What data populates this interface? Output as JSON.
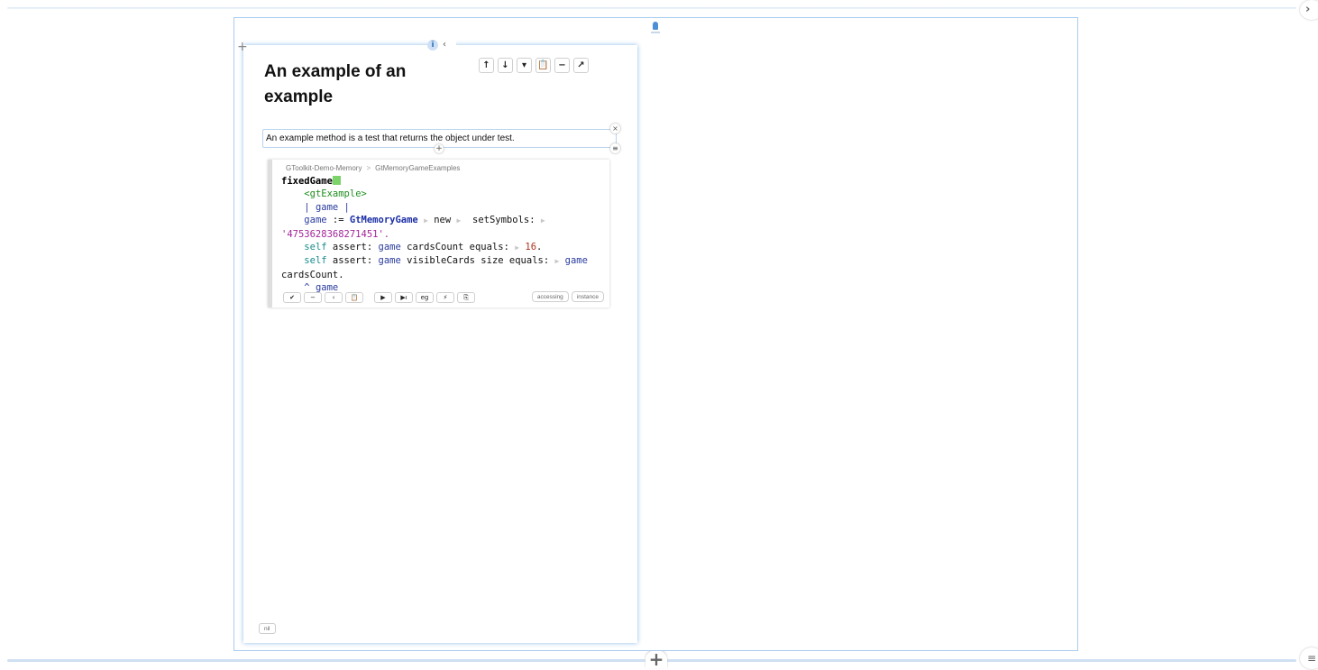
{
  "world": {
    "close_icon": "close-icon",
    "menu_icon": "menu-icon",
    "add_label": "+"
  },
  "page": {
    "title": "An example of an example",
    "add_label": "+",
    "tab_icon": "pin-icon",
    "tab_label": "ĭ",
    "tab_chevron": "‹",
    "toolbar": [
      {
        "name": "move-up-button",
        "glyph": "↑"
      },
      {
        "name": "move-down-button",
        "glyph": "↓"
      },
      {
        "name": "dropdown-button",
        "glyph": "▾"
      },
      {
        "name": "clipboard-button",
        "glyph": "📋"
      },
      {
        "name": "remove-button",
        "glyph": "−"
      },
      {
        "name": "share-button",
        "glyph": "↗"
      }
    ],
    "text_snippet": "An example method is a test that returns the object under test.",
    "snippet_close": "×",
    "snippet_menu": "≡",
    "snippet_add": "+",
    "nil_label": "nil"
  },
  "coder": {
    "package": "GToolkit-Demo-Memory",
    "separator": ">",
    "class": "GtMemoryGameExamples",
    "selector": "fixedGame",
    "pragma": "<gtExample>",
    "temp_decl": "| game |",
    "line_assign_var": "game",
    "line_assign_op": " := ",
    "line_assign_class": "GtMemoryGame",
    "msg_new": " new",
    "msg_setSymbols": "  setSymbols:",
    "symbols_string": "'4753628368271451'.",
    "self_kw": "self",
    "assert1_rest": " assert: ",
    "assert1_var": "game",
    "assert1_msg": " cardsCount equals:",
    "assert1_num": "16",
    "assert1_end": ".",
    "assert2_rest": " assert: ",
    "assert2_var": "game",
    "assert2_msg": " visibleCards size equals:",
    "assert2_var2": "game",
    "assert2_cont": "cardsCount.",
    "return_caret": "^ ",
    "return_var": "game",
    "actions": [
      {
        "name": "accept-button",
        "glyph": "✔"
      },
      {
        "name": "discard-button",
        "glyph": "−"
      },
      {
        "name": "collapse-button",
        "glyph": "‹"
      },
      {
        "name": "clipboard-button",
        "glyph": "📋"
      },
      {
        "name": "run-button",
        "glyph": "▶"
      },
      {
        "name": "run-inspect-button",
        "glyph": "▶ı"
      },
      {
        "name": "example-button",
        "glyph": "eg"
      },
      {
        "name": "debug-button",
        "glyph": "⚡"
      },
      {
        "name": "browse-button",
        "glyph": "⎘"
      }
    ],
    "tags": [
      "accessing",
      "instance"
    ]
  }
}
